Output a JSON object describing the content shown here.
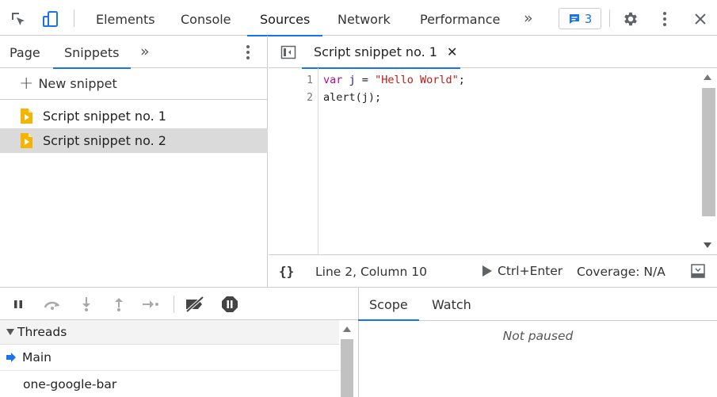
{
  "toolbar": {
    "tabs": [
      "Elements",
      "Console",
      "Sources",
      "Network",
      "Performance"
    ],
    "active_tab": "Sources",
    "more_tabs_glyph": "»",
    "issues_count": "3",
    "icons": [
      "inspect-element-icon",
      "device-toolbar-icon",
      "issues-icon",
      "settings-gear-icon",
      "more-options-icon",
      "close-icon"
    ]
  },
  "navigator": {
    "tabs": [
      "Page",
      "Snippets"
    ],
    "active_tab": "Snippets",
    "more_glyph": "»",
    "new_snippet_plus": "+",
    "new_snippet_label": "New snippet",
    "snippets": [
      "Script snippet no. 1",
      "Script snippet no. 2"
    ],
    "selected_snippet": "Script snippet no. 2"
  },
  "editor": {
    "tab_title": "Script snippet no. 1",
    "close_glyph": "✕",
    "lines": [
      {
        "number": "1",
        "keyword": "var",
        "variable": "j",
        "operator": " = ",
        "string": "\"Hello World\"",
        "end": ";"
      },
      {
        "number": "2",
        "text": "alert(j);"
      }
    ]
  },
  "status": {
    "format_label": "{}",
    "position": "Line 2, Column 10",
    "run_shortcut": "Ctrl+Enter",
    "coverage": "Coverage: N/A"
  },
  "debugger": {
    "controls": [
      "pause-icon",
      "step-over-icon",
      "step-into-icon",
      "step-out-icon",
      "step-icon",
      "deactivate-breakpoints-icon",
      "pause-on-exceptions-icon"
    ],
    "threads_header": "Threads",
    "threads": [
      "Main",
      "one-google-bar"
    ],
    "active_thread": "Main"
  },
  "scope": {
    "tabs": [
      "Scope",
      "Watch"
    ],
    "active_tab": "Scope",
    "message": "Not paused"
  },
  "colors": {
    "accent": "#1a73e8",
    "snippet_icon": "#f4b400",
    "keyword": "#aa0d91",
    "string": "#c41a16"
  }
}
